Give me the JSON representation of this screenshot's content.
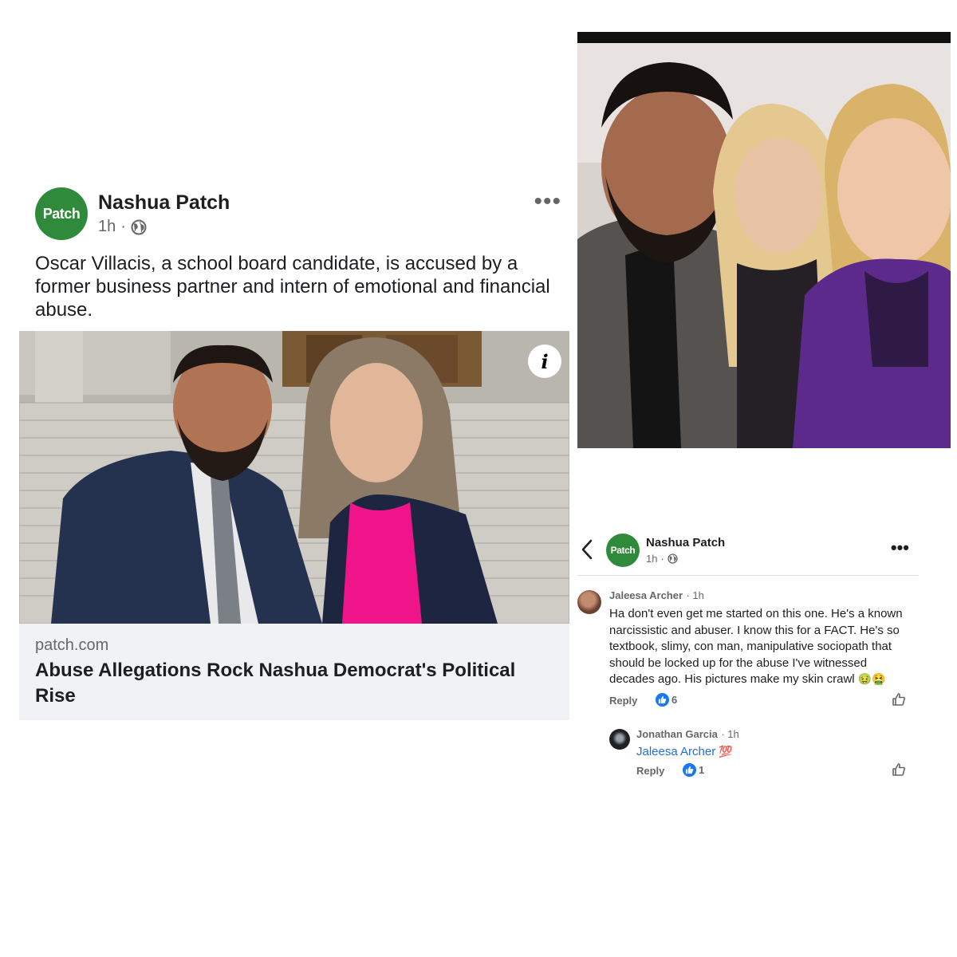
{
  "post": {
    "page_name": "Nashua Patch",
    "avatar_text": "Patch",
    "time": "1h",
    "separator": "·",
    "text": "Oscar Villacis, a school board candidate, is accused by a former business partner and intern of emotional and financial abuse.",
    "info_icon_text": "i",
    "link": {
      "domain": "patch.com",
      "title": "Abuse Allegations Rock Nashua Democrat's Political Rise"
    }
  },
  "comments_panel": {
    "page_name": "Nashua Patch",
    "avatar_text": "Patch",
    "time": "1h",
    "separator": "·",
    "more": "•••",
    "comments": [
      {
        "author": "Jaleesa Archer",
        "time": "· 1h",
        "text": "Ha don't even get me started on this one. He's a known narcissistic and abuser. I know this for a FACT. He's so textbook, slimy, con man, manipulative sociopath that should be locked up for the abuse I've witnessed decades ago. His pictures make my skin crawl",
        "emojis": "🤢🤮",
        "reply_label": "Reply",
        "like_count": "6"
      },
      {
        "author": "Jonathan Garcia",
        "time": "· 1h",
        "mention": "Jaleesa Archer",
        "emojis": "💯",
        "reply_label": "Reply",
        "like_count": "1"
      }
    ]
  },
  "colors": {
    "brand_green": "#2f8a3c",
    "link_blue": "#216fdb",
    "like_blue": "#1877f2",
    "muted_text": "#65676b"
  },
  "icons": [
    "globe-icon",
    "more-icon",
    "info-icon",
    "back-chevron-icon",
    "like-icon",
    "like-outline-icon"
  ]
}
